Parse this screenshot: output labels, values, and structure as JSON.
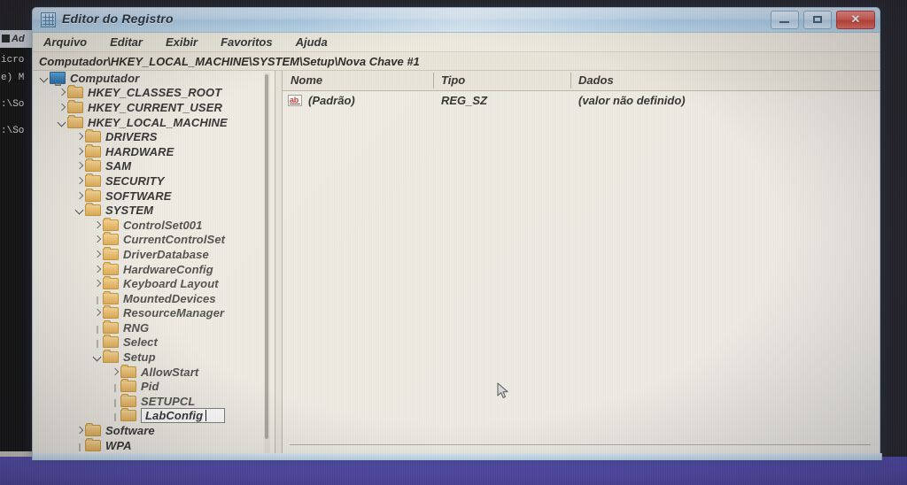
{
  "window": {
    "title": "Editor do Registro",
    "app_icon": "registry-editor-icon",
    "minimize_label": "",
    "maximize_label": "",
    "close_label": "✕"
  },
  "menubar": {
    "items": [
      {
        "label": "Arquivo"
      },
      {
        "label": "Editar"
      },
      {
        "label": "Exibir"
      },
      {
        "label": "Favoritos"
      },
      {
        "label": "Ajuda"
      }
    ]
  },
  "address": {
    "path": "Computador\\HKEY_LOCAL_MACHINE\\SYSTEM\\Setup\\Nova Chave #1"
  },
  "tree": {
    "rows": [
      {
        "label": "Computador",
        "indent": 0,
        "twisty": "expanded",
        "icon": "computer-icon"
      },
      {
        "label": "HKEY_CLASSES_ROOT",
        "indent": 1,
        "twisty": "collapsed",
        "icon": "folder-icon"
      },
      {
        "label": "HKEY_CURRENT_USER",
        "indent": 1,
        "twisty": "collapsed",
        "icon": "folder-icon"
      },
      {
        "label": "HKEY_LOCAL_MACHINE",
        "indent": 1,
        "twisty": "expanded",
        "icon": "folder-icon"
      },
      {
        "label": "DRIVERS",
        "indent": 2,
        "twisty": "collapsed",
        "icon": "folder-icon"
      },
      {
        "label": "HARDWARE",
        "indent": 2,
        "twisty": "collapsed",
        "icon": "folder-icon"
      },
      {
        "label": "SAM",
        "indent": 2,
        "twisty": "collapsed",
        "icon": "folder-icon"
      },
      {
        "label": "SECURITY",
        "indent": 2,
        "twisty": "collapsed",
        "icon": "folder-icon"
      },
      {
        "label": "SOFTWARE",
        "indent": 2,
        "twisty": "collapsed",
        "icon": "folder-icon"
      },
      {
        "label": "SYSTEM",
        "indent": 2,
        "twisty": "expanded",
        "icon": "folder-icon"
      },
      {
        "label": "ControlSet001",
        "indent": 3,
        "twisty": "collapsed",
        "icon": "folder-icon"
      },
      {
        "label": "CurrentControlSet",
        "indent": 3,
        "twisty": "collapsed",
        "icon": "folder-icon"
      },
      {
        "label": "DriverDatabase",
        "indent": 3,
        "twisty": "collapsed",
        "icon": "folder-icon"
      },
      {
        "label": "HardwareConfig",
        "indent": 3,
        "twisty": "collapsed",
        "icon": "folder-icon"
      },
      {
        "label": "Keyboard Layout",
        "indent": 3,
        "twisty": "collapsed",
        "icon": "folder-icon"
      },
      {
        "label": "MountedDevices",
        "indent": 3,
        "twisty": "leaf",
        "icon": "folder-icon"
      },
      {
        "label": "ResourceManager",
        "indent": 3,
        "twisty": "collapsed",
        "icon": "folder-icon"
      },
      {
        "label": "RNG",
        "indent": 3,
        "twisty": "leaf",
        "icon": "folder-icon"
      },
      {
        "label": "Select",
        "indent": 3,
        "twisty": "leaf",
        "icon": "folder-icon"
      },
      {
        "label": "Setup",
        "indent": 3,
        "twisty": "expanded",
        "icon": "folder-icon"
      },
      {
        "label": "AllowStart",
        "indent": 4,
        "twisty": "collapsed",
        "icon": "folder-icon"
      },
      {
        "label": "Pid",
        "indent": 4,
        "twisty": "leaf",
        "icon": "folder-icon"
      },
      {
        "label": "SETUPCL",
        "indent": 4,
        "twisty": "leaf",
        "icon": "folder-icon"
      },
      {
        "label": "LabConfig",
        "indent": 4,
        "twisty": "leaf",
        "icon": "folder-icon",
        "editing": true
      },
      {
        "label": "Software",
        "indent": 2,
        "twisty": "collapsed",
        "icon": "folder-icon"
      },
      {
        "label": "WPA",
        "indent": 2,
        "twisty": "leaf",
        "icon": "folder-icon"
      }
    ],
    "editing_value": "LabConfig"
  },
  "list": {
    "columns": [
      {
        "label": "Nome"
      },
      {
        "label": "Tipo"
      },
      {
        "label": "Dados"
      }
    ],
    "rows": [
      {
        "name": "(Padrão)",
        "type": "REG_SZ",
        "data": "(valor não definido)",
        "icon": "string-value-icon",
        "icon_text": "ab"
      }
    ]
  },
  "background": {
    "cmd_title": "Ad",
    "cmd_lines": [
      "icro",
      "e) M",
      ":\\So",
      ":\\So"
    ]
  },
  "cursor": {
    "type": "arrow-pointer"
  },
  "colors": {
    "title_bar": "#bdd8ee",
    "close_button": "#cf3e30",
    "window_body": "#efece3",
    "folder": "#edc070",
    "desktop": "#4b43a8",
    "string_icon": "#c0392b"
  }
}
